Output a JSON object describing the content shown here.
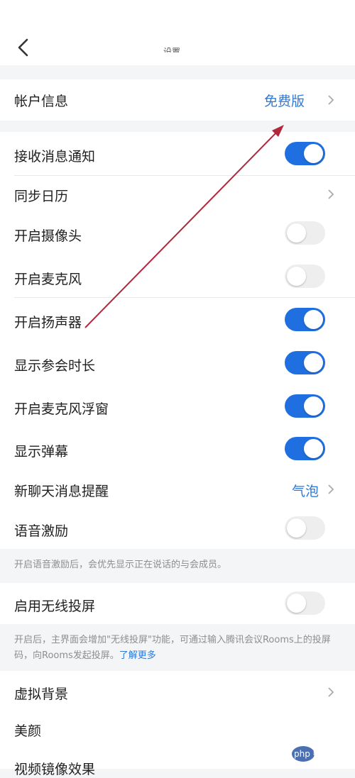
{
  "header": {
    "back_icon": "chevron-left-icon",
    "title_fragment": "设置"
  },
  "account": {
    "label": "帐户信息",
    "value": "免费版"
  },
  "settings": {
    "receive_notify": {
      "label": "接收消息通知",
      "enabled": true
    },
    "sync_calendar": {
      "label": "同步日历"
    },
    "camera": {
      "label": "开启摄像头",
      "enabled": false
    },
    "mic": {
      "label": "开启麦克风",
      "enabled": false
    },
    "speaker": {
      "label": "开启扬声器",
      "enabled": true
    },
    "show_duration": {
      "label": "显示参会时长",
      "enabled": true
    },
    "mic_float": {
      "label": "开启麦克风浮窗",
      "enabled": true
    },
    "danmaku": {
      "label": "显示弹幕",
      "enabled": true
    },
    "chat_reminder": {
      "label": "新聊天消息提醒",
      "value": "气泡"
    },
    "voice_excite": {
      "label": "语音激励",
      "enabled": false
    }
  },
  "voice_note": "开启语音激励后，会优先显示正在说话的与会成员。",
  "wireless": {
    "label": "启用无线投屏",
    "enabled": false
  },
  "wireless_note": {
    "text": "开启后，主界面会增加\"无线投屏\"功能，可通过输入腾讯会议Rooms上的投屏码，向Rooms发起投屏。",
    "link": "了解更多"
  },
  "video": {
    "virtual_bg": {
      "label": "虚拟背景"
    },
    "beauty": {
      "label": "美颜"
    },
    "mirror": {
      "label": "视频镜像效果"
    }
  },
  "watermark": {
    "text": "php 中文网"
  },
  "colors": {
    "accent": "#1f6fe0",
    "link": "#2f79d9",
    "annotation_arrow": "#b0283c"
  }
}
